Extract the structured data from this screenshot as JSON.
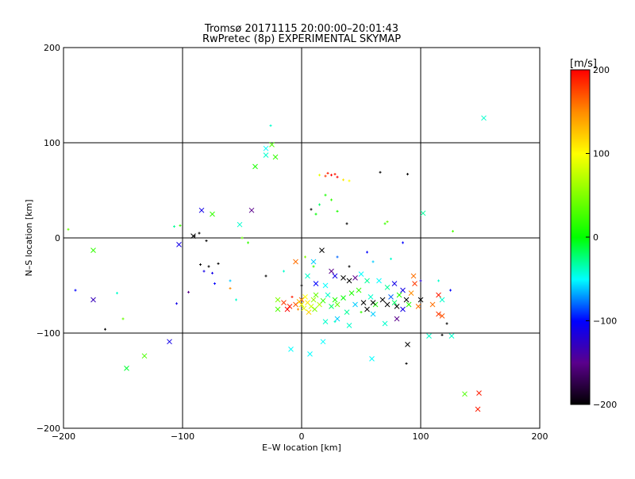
{
  "chart_data": {
    "type": "scatter",
    "title": "Tromsø 20171115 20:00:00–20:01:43",
    "subtitle": "RwPretec (8p) EXPERIMENTAL SKYMAP",
    "xlabel": "E–W location [km]",
    "ylabel": "N–S location [km]",
    "xlim": [
      -200,
      200
    ],
    "ylim": [
      -200,
      200
    ],
    "xticks": [
      -200,
      -100,
      0,
      100,
      200
    ],
    "yticks": [
      -200,
      -100,
      0,
      100,
      200
    ],
    "grid": true,
    "colorbar": {
      "label": "[m/s]",
      "range": [
        -200,
        200
      ],
      "ticks": [
        200,
        100,
        0,
        -100,
        -200
      ],
      "placement": "right"
    },
    "point_fields": [
      "x_km",
      "y_km",
      "velocity_ms",
      "is_cross"
    ],
    "points": [
      [
        153,
        126,
        -40,
        1
      ],
      [
        -25,
        98,
        30,
        1
      ],
      [
        -30,
        94,
        -50,
        1
      ],
      [
        -22,
        85,
        20,
        1
      ],
      [
        -39,
        75,
        10,
        1
      ],
      [
        -30,
        87,
        -40,
        1
      ],
      [
        -26,
        118,
        -40,
        0
      ],
      [
        -84,
        29,
        -110,
        1
      ],
      [
        -42,
        29,
        -150,
        1
      ],
      [
        -75,
        25,
        20,
        1
      ],
      [
        -52,
        14,
        -40,
        1
      ],
      [
        -103,
        -7,
        -110,
        1
      ],
      [
        -175,
        -13,
        20,
        1
      ],
      [
        -91,
        2,
        -200,
        1
      ],
      [
        -175,
        -65,
        -130,
        1
      ],
      [
        -111,
        -109,
        -110,
        1
      ],
      [
        -132,
        -124,
        30,
        1
      ],
      [
        -147,
        -137,
        -10,
        1
      ],
      [
        102,
        26,
        -30,
        1
      ],
      [
        -9,
        -117,
        -50,
        1
      ],
      [
        7,
        -122,
        -50,
        1
      ],
      [
        18,
        -109,
        -50,
        1
      ],
      [
        59,
        -127,
        -50,
        1
      ],
      [
        89,
        -112,
        -200,
        1
      ],
      [
        107,
        -103,
        -40,
        1
      ],
      [
        126,
        -103,
        -40,
        1
      ],
      [
        137,
        -164,
        30,
        1
      ],
      [
        149,
        -163,
        190,
        1
      ],
      [
        148,
        -180,
        190,
        1
      ],
      [
        22,
        68,
        190,
        0
      ],
      [
        25,
        66,
        200,
        0
      ],
      [
        28,
        67,
        190,
        0
      ],
      [
        20,
        65,
        180,
        0
      ],
      [
        30,
        64,
        200,
        0
      ],
      [
        35,
        61,
        110,
        0
      ],
      [
        40,
        60,
        100,
        0
      ],
      [
        15,
        66,
        90,
        0
      ],
      [
        66,
        69,
        -200,
        0
      ],
      [
        89,
        67,
        -200,
        0
      ],
      [
        20,
        45,
        10,
        0
      ],
      [
        25,
        40,
        20,
        0
      ],
      [
        15,
        35,
        -20,
        0
      ],
      [
        12,
        25,
        0,
        0
      ],
      [
        30,
        28,
        10,
        0
      ],
      [
        38,
        15,
        -200,
        0
      ],
      [
        8,
        30,
        -200,
        0
      ],
      [
        70,
        15,
        20,
        0
      ],
      [
        72,
        17,
        40,
        0
      ],
      [
        127,
        7,
        30,
        0
      ],
      [
        -196,
        9,
        40,
        0
      ],
      [
        -107,
        12,
        -30,
        0
      ],
      [
        -102,
        13,
        20,
        0
      ],
      [
        -86,
        5,
        -200,
        0
      ],
      [
        -90,
        2,
        -200,
        0
      ],
      [
        -80,
        -3,
        -200,
        0
      ],
      [
        -85,
        -28,
        -200,
        0
      ],
      [
        -78,
        -30,
        -200,
        0
      ],
      [
        -70,
        -27,
        -200,
        0
      ],
      [
        -82,
        -35,
        -110,
        0
      ],
      [
        -75,
        -37,
        -110,
        0
      ],
      [
        -73,
        -48,
        -100,
        0
      ],
      [
        -60,
        -53,
        150,
        0
      ],
      [
        -55,
        -65,
        -40,
        0
      ],
      [
        -60,
        -45,
        -60,
        0
      ],
      [
        -95,
        -57,
        -150,
        0
      ],
      [
        -105,
        -69,
        -110,
        0
      ],
      [
        -165,
        -96,
        -200,
        0
      ],
      [
        -150,
        -85,
        40,
        0
      ],
      [
        -190,
        -55,
        -100,
        0
      ],
      [
        -155,
        -58,
        -40,
        0
      ],
      [
        -45,
        -5,
        20,
        0
      ],
      [
        -50,
        0,
        40,
        0
      ],
      [
        17,
        -13,
        -200,
        1
      ],
      [
        10,
        -25,
        -60,
        1
      ],
      [
        -5,
        -25,
        160,
        1
      ],
      [
        3,
        -20,
        50,
        0
      ],
      [
        -15,
        -35,
        -40,
        0
      ],
      [
        -15,
        -68,
        180,
        1
      ],
      [
        -10,
        -72,
        190,
        1
      ],
      [
        -5,
        -70,
        170,
        1
      ],
      [
        -12,
        -75,
        200,
        1
      ],
      [
        0,
        -65,
        160,
        1
      ],
      [
        -8,
        -62,
        190,
        0
      ],
      [
        -3,
        -75,
        150,
        0
      ],
      [
        -20,
        -65,
        50,
        1
      ],
      [
        -20,
        -75,
        30,
        1
      ],
      [
        0,
        -70,
        90,
        1
      ],
      [
        5,
        -68,
        110,
        1
      ],
      [
        8,
        -72,
        80,
        1
      ],
      [
        10,
        -65,
        60,
        1
      ],
      [
        12,
        -60,
        40,
        1
      ],
      [
        3,
        -62,
        100,
        1
      ],
      [
        15,
        -70,
        70,
        1
      ],
      [
        18,
        -66,
        20,
        1
      ],
      [
        6,
        -78,
        120,
        1
      ],
      [
        2,
        -74,
        90,
        1
      ],
      [
        -2,
        -67,
        130,
        1
      ],
      [
        11,
        -75,
        50,
        1
      ],
      [
        22,
        -60,
        -40,
        1
      ],
      [
        25,
        -72,
        -20,
        1
      ],
      [
        28,
        -65,
        10,
        1
      ],
      [
        30,
        -70,
        40,
        1
      ],
      [
        35,
        -63,
        0,
        1
      ],
      [
        38,
        -78,
        -30,
        1
      ],
      [
        42,
        -58,
        10,
        1
      ],
      [
        45,
        -70,
        -60,
        1
      ],
      [
        48,
        -55,
        20,
        1
      ],
      [
        52,
        -68,
        -200,
        1
      ],
      [
        55,
        -75,
        -200,
        1
      ],
      [
        58,
        -62,
        -40,
        1
      ],
      [
        60,
        -80,
        -60,
        1
      ],
      [
        62,
        -70,
        10,
        1
      ],
      [
        35,
        -42,
        -200,
        1
      ],
      [
        40,
        -45,
        -200,
        1
      ],
      [
        28,
        -40,
        -110,
        1
      ],
      [
        45,
        -42,
        -150,
        1
      ],
      [
        50,
        -38,
        -50,
        1
      ],
      [
        55,
        -45,
        -30,
        1
      ],
      [
        20,
        -50,
        -50,
        1
      ],
      [
        12,
        -48,
        -100,
        1
      ],
      [
        5,
        -40,
        -40,
        1
      ],
      [
        25,
        -35,
        -150,
        1
      ],
      [
        30,
        -85,
        -60,
        1
      ],
      [
        40,
        -92,
        -40,
        1
      ],
      [
        20,
        -88,
        -40,
        1
      ],
      [
        68,
        -65,
        -200,
        1
      ],
      [
        72,
        -70,
        -200,
        1
      ],
      [
        75,
        -62,
        -80,
        1
      ],
      [
        78,
        -68,
        -20,
        1
      ],
      [
        80,
        -72,
        -200,
        1
      ],
      [
        82,
        -60,
        10,
        1
      ],
      [
        85,
        -75,
        -110,
        1
      ],
      [
        88,
        -65,
        -200,
        1
      ],
      [
        90,
        -70,
        10,
        1
      ],
      [
        92,
        -58,
        150,
        1
      ],
      [
        95,
        -48,
        180,
        1
      ],
      [
        94,
        -40,
        160,
        1
      ],
      [
        100,
        -65,
        -200,
        1
      ],
      [
        98,
        -72,
        160,
        1
      ],
      [
        110,
        -70,
        160,
        1
      ],
      [
        115,
        -80,
        180,
        1
      ],
      [
        118,
        -82,
        170,
        1
      ],
      [
        115,
        -60,
        190,
        1
      ],
      [
        118,
        -65,
        -40,
        1
      ],
      [
        72,
        -52,
        -30,
        1
      ],
      [
        65,
        -45,
        -50,
        1
      ],
      [
        78,
        -48,
        -110,
        1
      ],
      [
        85,
        -55,
        -110,
        1
      ],
      [
        80,
        -85,
        -150,
        1
      ],
      [
        70,
        -90,
        -40,
        1
      ],
      [
        60,
        -68,
        -200,
        1
      ],
      [
        30,
        -20,
        -80,
        0
      ],
      [
        55,
        -15,
        -100,
        0
      ],
      [
        85,
        -5,
        -100,
        0
      ],
      [
        100,
        -45,
        -120,
        0
      ],
      [
        115,
        -45,
        -40,
        0
      ],
      [
        125,
        -55,
        -100,
        0
      ],
      [
        40,
        -30,
        -200,
        0
      ],
      [
        60,
        -25,
        -60,
        0
      ],
      [
        75,
        -22,
        -40,
        0
      ],
      [
        -30,
        -40,
        -200,
        0
      ],
      [
        122,
        -90,
        -200,
        0
      ],
      [
        118,
        -102,
        -200,
        0
      ],
      [
        88,
        -132,
        -200,
        0
      ],
      [
        50,
        -78,
        20,
        0
      ],
      [
        28,
        -88,
        -40,
        0
      ],
      [
        10,
        -30,
        20,
        0
      ],
      [
        0,
        -50,
        -200,
        0
      ]
    ]
  }
}
